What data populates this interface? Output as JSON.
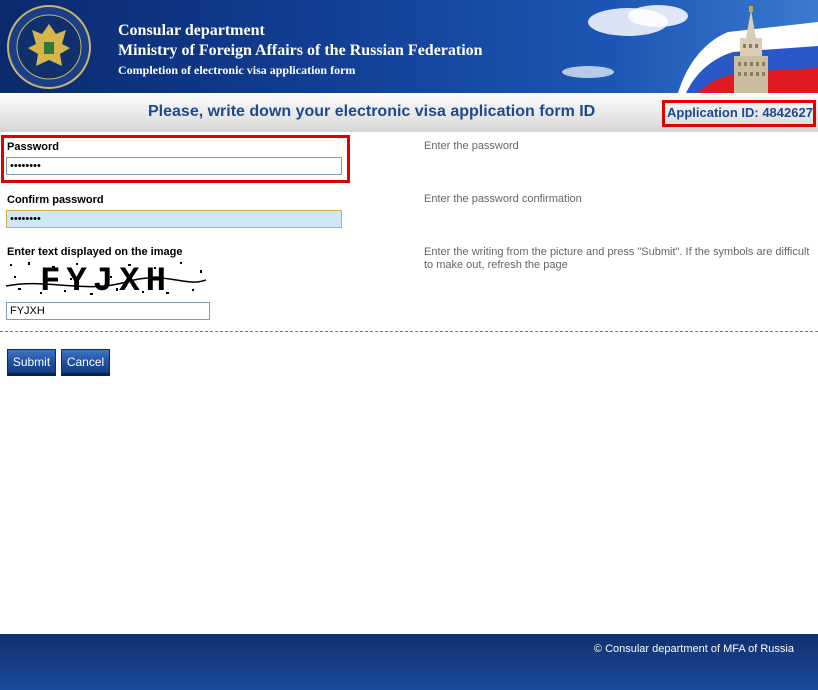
{
  "header": {
    "line1": "Consular department",
    "line2": "Ministry of Foreign Affairs of the Russian Federation",
    "line3": "Completion of electronic visa application form",
    "emblem_icon": "consular-emblem-icon",
    "artwork": "russian-flag-and-building-icon"
  },
  "titlebar": {
    "title": "Please, write down your electronic visa application form ID",
    "application_id": "Application ID: 4842627"
  },
  "form": {
    "password": {
      "label": "Password",
      "value": "••••••••",
      "hint": "Enter the password"
    },
    "confirm_password": {
      "label": "Confirm password",
      "value": "••••••••",
      "hint": "Enter the password confirmation"
    },
    "captcha": {
      "label": "Enter text displayed on the image",
      "image_text": "FYJXH",
      "value": "FYJXH",
      "hint": "Enter the writing from the picture and press \"Submit\". If the symbols are difficult to make out, refresh the page"
    }
  },
  "buttons": {
    "submit": "Submit",
    "cancel": "Cancel"
  },
  "footer": {
    "copyright": "© Consular department of MFA of Russia"
  },
  "colors": {
    "header_blue": "#123e94",
    "title_blue": "#1d4a8c",
    "highlight_red": "#e00000",
    "button_blue": "#1f4f9e",
    "focus_field": "#cfe8f6"
  }
}
